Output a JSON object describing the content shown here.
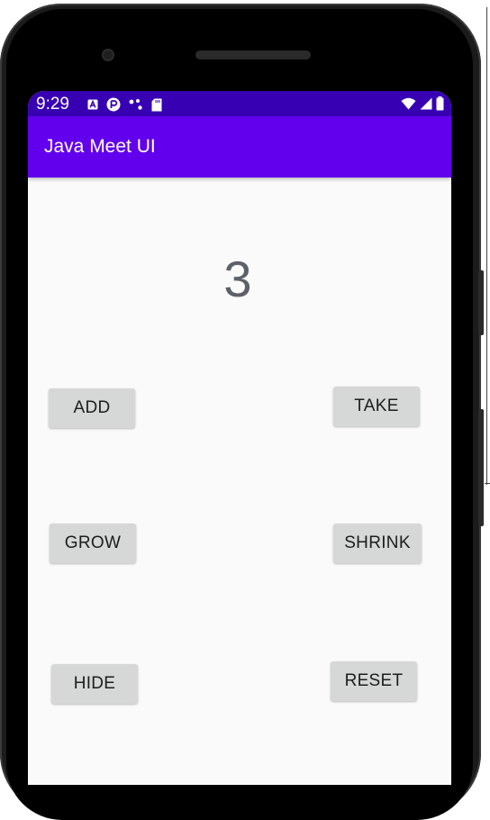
{
  "status_bar": {
    "time": "9:29",
    "left_icons": [
      "a-box-icon",
      "play-badge-icon",
      "dots-icon",
      "sd-card-icon"
    ],
    "right_icons": [
      "wifi-icon",
      "cell-signal-icon",
      "battery-icon"
    ],
    "color": "#3700b3"
  },
  "app_bar": {
    "title": "Java Meet UI",
    "color": "#6200ee"
  },
  "main": {
    "counter": "3",
    "buttons": {
      "add": "ADD",
      "take": "TAKE",
      "grow": "GROW",
      "shrink": "SHRINK",
      "hide": "HIDE",
      "reset": "RESET"
    }
  }
}
